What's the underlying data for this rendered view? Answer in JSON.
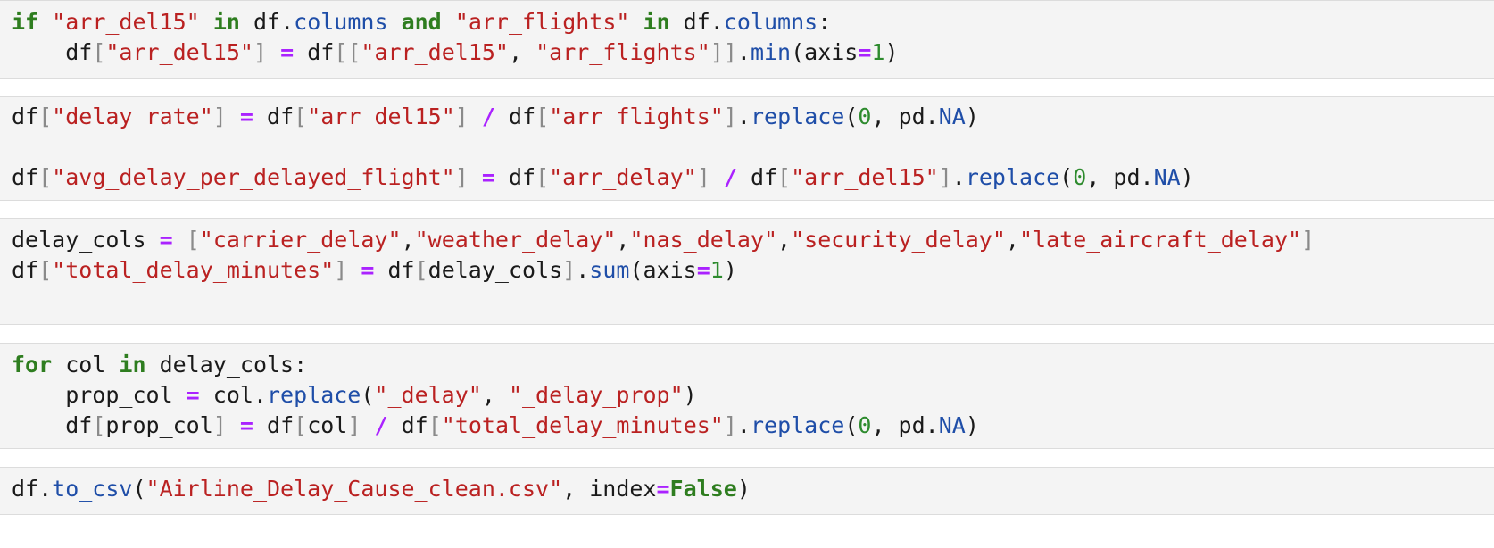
{
  "cells": [
    {
      "lines": [
        [
          [
            "kw",
            "if"
          ],
          [
            "t",
            " "
          ],
          [
            "str",
            "\"arr_del15\""
          ],
          [
            "t",
            " "
          ],
          [
            "kw",
            "in"
          ],
          [
            "t",
            " df."
          ],
          [
            "fn",
            "columns"
          ],
          [
            "t",
            " "
          ],
          [
            "kw",
            "and"
          ],
          [
            "t",
            " "
          ],
          [
            "str",
            "\"arr_flights\""
          ],
          [
            "t",
            " "
          ],
          [
            "kw",
            "in"
          ],
          [
            "t",
            " df."
          ],
          [
            "fn",
            "columns"
          ],
          [
            "t",
            ":"
          ]
        ],
        [
          [
            "t",
            "    df"
          ],
          [
            "br",
            "["
          ],
          [
            "str",
            "\"arr_del15\""
          ],
          [
            "br",
            "]"
          ],
          [
            "t",
            " "
          ],
          [
            "op",
            "="
          ],
          [
            "t",
            " df"
          ],
          [
            "br",
            "[["
          ],
          [
            "str",
            "\"arr_del15\""
          ],
          [
            "t",
            ", "
          ],
          [
            "str",
            "\"arr_flights\""
          ],
          [
            "br",
            "]]"
          ],
          [
            "t",
            "."
          ],
          [
            "fn",
            "min"
          ],
          [
            "t",
            "(axis"
          ],
          [
            "op",
            "="
          ],
          [
            "num",
            "1"
          ],
          [
            "t",
            ")"
          ]
        ]
      ]
    },
    {
      "lines": [
        [
          [
            "t",
            "df"
          ],
          [
            "br",
            "["
          ],
          [
            "str",
            "\"delay_rate\""
          ],
          [
            "br",
            "]"
          ],
          [
            "t",
            " "
          ],
          [
            "op",
            "="
          ],
          [
            "t",
            " df"
          ],
          [
            "br",
            "["
          ],
          [
            "str",
            "\"arr_del15\""
          ],
          [
            "br",
            "]"
          ],
          [
            "t",
            " "
          ],
          [
            "op",
            "/"
          ],
          [
            "t",
            " df"
          ],
          [
            "br",
            "["
          ],
          [
            "str",
            "\"arr_flights\""
          ],
          [
            "br",
            "]"
          ],
          [
            "t",
            "."
          ],
          [
            "fn",
            "replace"
          ],
          [
            "t",
            "("
          ],
          [
            "num",
            "0"
          ],
          [
            "t",
            ", pd."
          ],
          [
            "fn",
            "NA"
          ],
          [
            "t",
            ")"
          ]
        ],
        [],
        [
          [
            "t",
            "df"
          ],
          [
            "br",
            "["
          ],
          [
            "str",
            "\"avg_delay_per_delayed_flight\""
          ],
          [
            "br",
            "]"
          ],
          [
            "t",
            " "
          ],
          [
            "op",
            "="
          ],
          [
            "t",
            " df"
          ],
          [
            "br",
            "["
          ],
          [
            "str",
            "\"arr_delay\""
          ],
          [
            "br",
            "]"
          ],
          [
            "t",
            " "
          ],
          [
            "op",
            "/"
          ],
          [
            "t",
            " df"
          ],
          [
            "br",
            "["
          ],
          [
            "str",
            "\"arr_del15\""
          ],
          [
            "br",
            "]"
          ],
          [
            "t",
            "."
          ],
          [
            "fn",
            "replace"
          ],
          [
            "t",
            "("
          ],
          [
            "num",
            "0"
          ],
          [
            "t",
            ", pd."
          ],
          [
            "fn",
            "NA"
          ],
          [
            "t",
            ")"
          ]
        ]
      ]
    },
    {
      "lines": [
        [
          [
            "t",
            "delay_cols "
          ],
          [
            "op",
            "="
          ],
          [
            "t",
            " "
          ],
          [
            "br",
            "["
          ],
          [
            "str",
            "\"carrier_delay\""
          ],
          [
            "t",
            ","
          ],
          [
            "str",
            "\"weather_delay\""
          ],
          [
            "t",
            ","
          ],
          [
            "str",
            "\"nas_delay\""
          ],
          [
            "t",
            ","
          ],
          [
            "str",
            "\"security_delay\""
          ],
          [
            "t",
            ","
          ],
          [
            "str",
            "\"late_aircraft_delay\""
          ],
          [
            "br",
            "]"
          ]
        ],
        [
          [
            "t",
            "df"
          ],
          [
            "br",
            "["
          ],
          [
            "str",
            "\"total_delay_minutes\""
          ],
          [
            "br",
            "]"
          ],
          [
            "t",
            " "
          ],
          [
            "op",
            "="
          ],
          [
            "t",
            " df"
          ],
          [
            "br",
            "["
          ],
          [
            "t",
            "delay_cols"
          ],
          [
            "br",
            "]"
          ],
          [
            "t",
            "."
          ],
          [
            "fn",
            "sum"
          ],
          [
            "t",
            "(axis"
          ],
          [
            "op",
            "="
          ],
          [
            "num",
            "1"
          ],
          [
            "t",
            ")"
          ]
        ]
      ]
    },
    {
      "lines": [
        [
          [
            "kw",
            "for"
          ],
          [
            "t",
            " col "
          ],
          [
            "kw",
            "in"
          ],
          [
            "t",
            " delay_cols:"
          ]
        ],
        [
          [
            "t",
            "    prop_col "
          ],
          [
            "op",
            "="
          ],
          [
            "t",
            " col."
          ],
          [
            "fn",
            "replace"
          ],
          [
            "t",
            "("
          ],
          [
            "str",
            "\"_delay\""
          ],
          [
            "t",
            ", "
          ],
          [
            "str",
            "\"_delay_prop\""
          ],
          [
            "t",
            ")"
          ]
        ],
        [
          [
            "t",
            "    df"
          ],
          [
            "br",
            "["
          ],
          [
            "t",
            "prop_col"
          ],
          [
            "br",
            "]"
          ],
          [
            "t",
            " "
          ],
          [
            "op",
            "="
          ],
          [
            "t",
            " df"
          ],
          [
            "br",
            "["
          ],
          [
            "t",
            "col"
          ],
          [
            "br",
            "]"
          ],
          [
            "t",
            " "
          ],
          [
            "op",
            "/"
          ],
          [
            "t",
            " df"
          ],
          [
            "br",
            "["
          ],
          [
            "str",
            "\"total_delay_minutes\""
          ],
          [
            "br",
            "]"
          ],
          [
            "t",
            "."
          ],
          [
            "fn",
            "replace"
          ],
          [
            "t",
            "("
          ],
          [
            "num",
            "0"
          ],
          [
            "t",
            ", pd."
          ],
          [
            "fn",
            "NA"
          ],
          [
            "t",
            ")"
          ]
        ]
      ]
    },
    {
      "lines": [
        [
          [
            "t",
            "df."
          ],
          [
            "fn",
            "to_csv"
          ],
          [
            "t",
            "("
          ],
          [
            "str",
            "\"Airline_Delay_Cause_clean.csv\""
          ],
          [
            "t",
            ", index"
          ],
          [
            "op",
            "="
          ],
          [
            "kw",
            "False"
          ],
          [
            "t",
            ")"
          ]
        ]
      ]
    }
  ]
}
